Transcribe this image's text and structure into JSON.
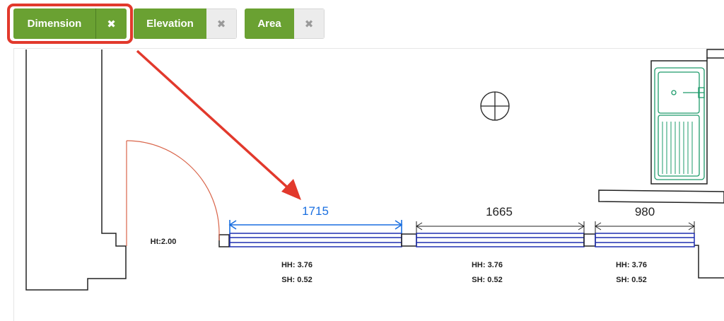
{
  "tabs": [
    {
      "label": "Dimension",
      "close": "✖",
      "state": "active"
    },
    {
      "label": "Elevation",
      "close": "✖",
      "state": "inactive"
    },
    {
      "label": "Area",
      "close": "✖",
      "state": "inactive"
    }
  ],
  "drawing": {
    "door_label": "Ht:2.00",
    "dimensions": [
      {
        "value": "1715",
        "color": "#1a6fe0",
        "selected": true
      },
      {
        "value": "1665",
        "color": "#222222",
        "selected": false
      },
      {
        "value": "980",
        "color": "#222222",
        "selected": false
      }
    ],
    "windows": [
      {
        "hh": "HH: 3.76",
        "sh": "SH: 0.52"
      },
      {
        "hh": "HH: 3.76",
        "sh": "SH: 0.52"
      },
      {
        "hh": "HH: 3.76",
        "sh": "SH: 0.52"
      }
    ]
  },
  "colors": {
    "tab_green": "#6aa132",
    "callout_red": "#e2392c",
    "window_blue": "#1f2fb0",
    "sink_green": "#1e9b6b",
    "door_orange": "#d9654a"
  }
}
